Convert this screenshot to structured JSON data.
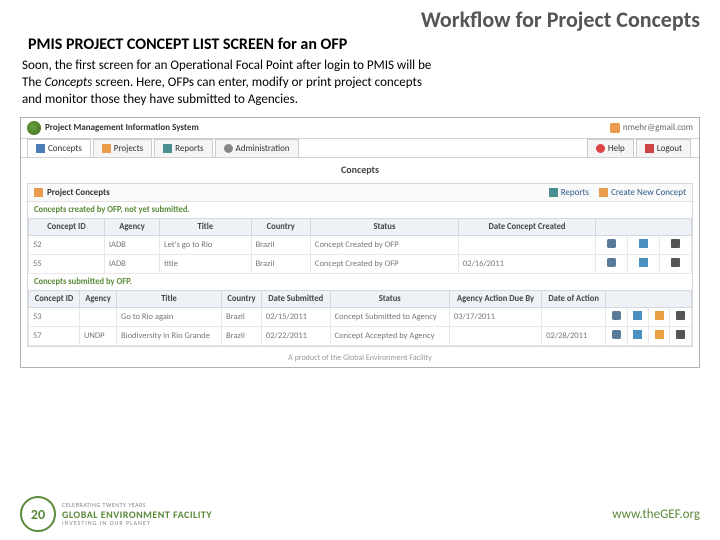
{
  "slide": {
    "title": "Workflow for Project Concepts",
    "section_title": "PMIS PROJECT CONCEPT LIST SCREEN for an OFP",
    "body_1": "Soon, the first screen for an Operational Focal Point after login to PMIS will be",
    "body_2a": "The ",
    "body_2b": "Concepts",
    "body_2c": " screen. Here, OFPs can enter, modify or print project concepts",
    "body_3": "and monitor those they have submitted to Agencies."
  },
  "app": {
    "title": "Project Management Information System",
    "user": "nmehr@gmail.com",
    "tabs": {
      "concepts": "Concepts",
      "projects": "Projects",
      "reports": "Reports",
      "admin": "Administration",
      "help": "Help",
      "logout": "Logout"
    },
    "page_title": "Concepts"
  },
  "panel": {
    "title": "Project Concepts",
    "reports": "Reports",
    "create": "Create New Concept"
  },
  "table1": {
    "caption": "Concepts created by OFP, not yet submitted.",
    "headers": {
      "id": "Concept ID",
      "agency": "Agency",
      "title": "Title",
      "country": "Country",
      "status": "Status",
      "date": "Date Concept Created"
    },
    "rows": [
      {
        "id": "52",
        "agency": "IADB",
        "title": "Let's go to Rio",
        "country": "Brazil",
        "status": "Concept Created by OFP",
        "date": ""
      },
      {
        "id": "55",
        "agency": "IADB",
        "title": "title",
        "country": "Brazil",
        "status": "Concept Created by OFP",
        "date": "02/16/2011"
      }
    ]
  },
  "table2": {
    "caption": "Concepts submitted by OFP.",
    "headers": {
      "id": "Concept ID",
      "agency": "Agency",
      "title": "Title",
      "country": "Country",
      "date_sub": "Date Submitted",
      "status": "Status",
      "action_due": "Agency Action Due By",
      "date_action": "Date of Action"
    },
    "rows": [
      {
        "id": "53",
        "agency": "",
        "title": "Go to Rio again",
        "country": "Brazil",
        "date_sub": "02/15/2011",
        "status": "Concept Submitted to Agency",
        "action_due": "03/17/2011",
        "date_action": ""
      },
      {
        "id": "57",
        "agency": "UNDP",
        "title": "Biodiversity in Rio Grande",
        "country": "Brazil",
        "date_sub": "02/22/2011",
        "status": "Concept Accepted by Agency",
        "action_due": "",
        "date_action": "02/28/2011"
      }
    ]
  },
  "footer_text": "A product of the Global Environment Facility",
  "gef": {
    "badge_top": "CELEBRATING",
    "badge_num": "20",
    "badge_bot": "YEARS",
    "line1": "CELEBRATING TWENTY YEARS",
    "line2": "GLOBAL ENVIRONMENT FACILITY",
    "line3": "INVESTING IN OUR PLANET",
    "url": "www.theGEF.org"
  }
}
